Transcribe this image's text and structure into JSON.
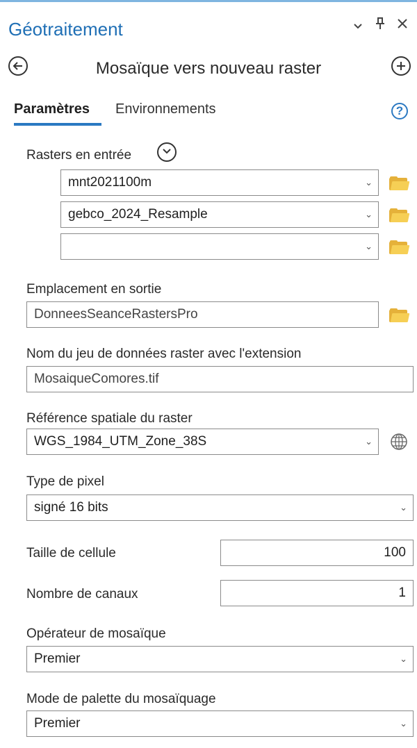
{
  "pane": {
    "title": "Géotraitement",
    "controls": {
      "menu": "⌄",
      "pin": "⊥",
      "close": "✕"
    }
  },
  "tool": {
    "title": "Mosaïque vers nouveau raster"
  },
  "tabs": [
    {
      "label": "Paramètres",
      "active": true
    },
    {
      "label": "Environnements",
      "active": false
    }
  ],
  "help_label": "?",
  "params": {
    "input_rasters": {
      "label": "Rasters en entrée",
      "items": [
        "mnt2021100m",
        "gebco_2024_Resample",
        ""
      ]
    },
    "output_location": {
      "label": "Emplacement en sortie",
      "value": "DonneesSeanceRastersPro"
    },
    "dataset_name": {
      "label": "Nom du jeu de données raster avec l'extension",
      "value": "MosaiqueComores.tif"
    },
    "spatial_reference": {
      "label": "Référence spatiale du raster",
      "value": "WGS_1984_UTM_Zone_38S"
    },
    "pixel_type": {
      "label": "Type de pixel",
      "value": "signé 16 bits"
    },
    "cell_size": {
      "label": "Taille de cellule",
      "value": "100"
    },
    "band_count": {
      "label": "Nombre de canaux",
      "value": "1"
    },
    "mosaic_operator": {
      "label": "Opérateur de mosaïque",
      "value": "Premier"
    },
    "colormap_mode": {
      "label": "Mode de palette du mosaïquage",
      "value": "Premier"
    }
  },
  "chevron": "⌄",
  "colors": {
    "accent": "#2b79c2",
    "title": "#1f6fb5",
    "folder": "#f6cf55"
  }
}
